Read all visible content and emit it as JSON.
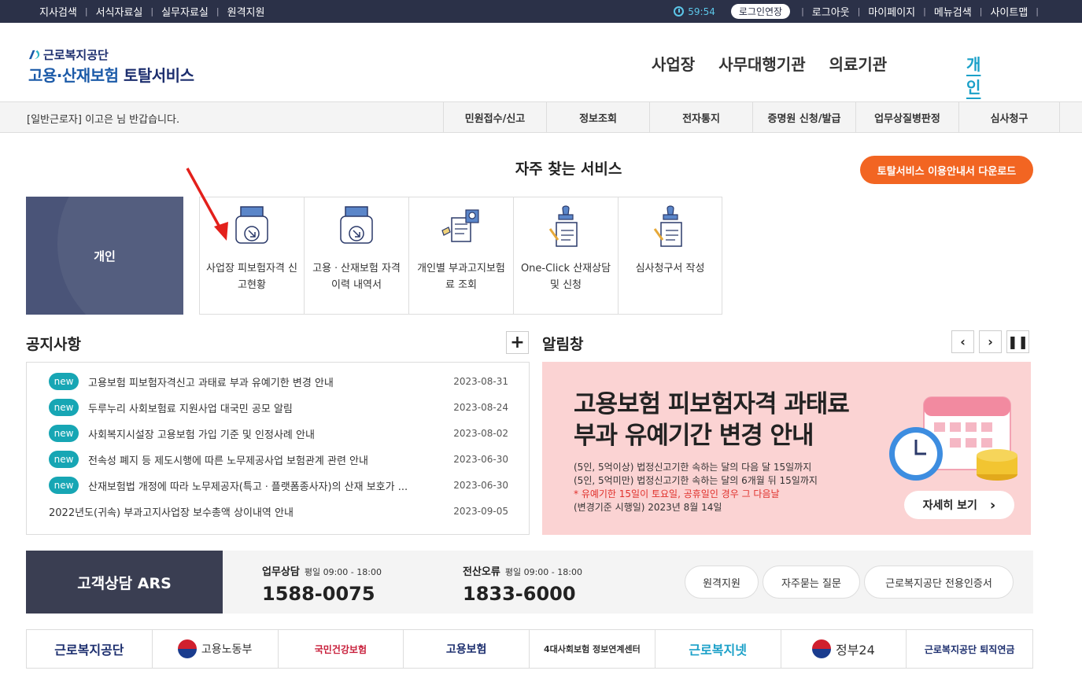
{
  "util": {
    "left": [
      "지사검색",
      "서식자료실",
      "실무자료실",
      "원격지원"
    ],
    "timer": "59:54",
    "extend": "로그인연장",
    "right": [
      "로그아웃",
      "마이페이지",
      "메뉴검색",
      "사이트맵"
    ]
  },
  "header": {
    "org": "근로복지공단",
    "title_a": "고용·산재보험",
    "title_b": " 토탈서비스",
    "gnb": [
      "사업장",
      "사무대행기관",
      "의료기관"
    ],
    "gnb_active": "개인"
  },
  "subbar": {
    "greeting": "[일반근로자] 이고은 님 반갑습니다.",
    "menu": [
      "민원접수/신고",
      "정보조회",
      "전자통지",
      "증명원 신청/발급",
      "업무상질병판정",
      "심사청구"
    ]
  },
  "favorites": {
    "title": "자주 찾는 서비스",
    "guide_button": "토탈서비스 이용안내서 다운로드",
    "person": "개인",
    "services": [
      {
        "label": "사업장 피보험자격 신고현황",
        "icon": "document-tray-icon"
      },
      {
        "label": "고용ㆍ산재보험 자격 이력 내역서",
        "icon": "document-tray-icon"
      },
      {
        "label": "개인별 부과고지보험료 조회",
        "icon": "document-search-icon"
      },
      {
        "label": "One-Click 산재상담 및 신청",
        "icon": "document-stamp-icon"
      },
      {
        "label": "심사청구서 작성",
        "icon": "document-stamp-icon"
      }
    ]
  },
  "notice": {
    "title": "공지사항",
    "more": "+",
    "badge": "new",
    "items": [
      {
        "new": true,
        "text": "고용보험 피보험자격신고 과태료 부과 유예기한 변경 안내",
        "date": "2023-08-31"
      },
      {
        "new": true,
        "text": "두루누리 사회보험료 지원사업 대국민 공모 알림",
        "date": "2023-08-24"
      },
      {
        "new": true,
        "text": "사회복지시설장 고용보험 가입 기준 및 인정사례 안내",
        "date": "2023-08-02"
      },
      {
        "new": true,
        "text": "전속성 폐지 등 제도시행에 따른 노무제공사업 보험관계 관련 안내",
        "date": "2023-06-30"
      },
      {
        "new": true,
        "text": "산재보험법 개정에 따라 노무제공자(특고ㆍ플랫폼종사자)의 산재 보호가 ...",
        "date": "2023-06-30"
      },
      {
        "new": false,
        "text": "2022년도(귀속) 부과고지사업장 보수총액 상이내역 안내",
        "date": "2023-09-05"
      }
    ]
  },
  "alert": {
    "title": "알림창",
    "headline1": "고용보험 피보험자격 과태료",
    "headline2": "부과 유예기간 변경 안내",
    "line1": "(5인, 5억이상) 법정신고기한 속하는 달의 다음 달 15일까지",
    "line2": "(5인, 5억미만) 법정신고기한 속하는 달의 6개월 뒤 15일까지",
    "line3": "* 유예기한 15일이 토요일, 공휴일인 경우 그 다음날",
    "line4": "(변경기준 시행일) 2023년 8월 14일",
    "detail": "자세히 보기"
  },
  "ars": {
    "title": "고객상담 ARS",
    "work_label": "업무상담",
    "work_hours": "평일 09:00 - 18:00",
    "work_tel": "1588-0075",
    "err_label": "전산오류",
    "err_hours": "평일 09:00 - 18:00",
    "err_tel": "1833-6000",
    "buttons": [
      "원격지원",
      "자주묻는 질문",
      "근로복지공단 전용인증서"
    ]
  },
  "footer_logos": [
    "근로복지공단",
    "고용노동부",
    "국민건강보험",
    "고용보험",
    "4대사회보험 정보연계센터",
    "근로복지넷",
    "정부24",
    "근로복지공단 퇴직연금"
  ],
  "colors": {
    "navy": "#2b3148",
    "accent": "#f26522",
    "teal": "#17a6b4",
    "active": "#1aa0c8"
  }
}
